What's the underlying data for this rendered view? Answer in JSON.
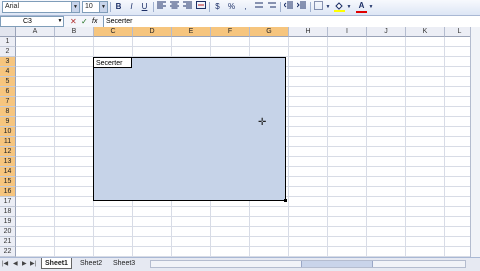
{
  "toolbar": {
    "font_name": "Arial",
    "font_size": "10",
    "bold": "B",
    "italic": "I",
    "underline": "U",
    "currency": "$",
    "percent": "%",
    "comma": ",",
    "fill_color_icon": "paint-bucket-icon",
    "font_color_icon": "font-color-a-icon",
    "font_color_glyph": "A"
  },
  "formula_bar": {
    "name_box": "C3",
    "cancel": "✕",
    "enter": "✓",
    "fx": "fx",
    "content": "Secerter"
  },
  "columns": [
    "A",
    "B",
    "C",
    "D",
    "E",
    "F",
    "G",
    "H",
    "I",
    "J",
    "K",
    "L"
  ],
  "selected_columns": [
    "C",
    "D",
    "E",
    "F",
    "G"
  ],
  "rows": [
    "1",
    "2",
    "3",
    "4",
    "5",
    "6",
    "7",
    "8",
    "9",
    "10",
    "11",
    "12",
    "13",
    "14",
    "15",
    "16",
    "17",
    "18",
    "19",
    "20",
    "21",
    "22"
  ],
  "selected_rows": [
    "3",
    "4",
    "5",
    "6",
    "7",
    "8",
    "9",
    "10",
    "11",
    "12",
    "13",
    "14",
    "15",
    "16"
  ],
  "active_cell": {
    "ref": "C3",
    "value": "Secerter"
  },
  "sheet_tabs": [
    "Sheet1",
    "Sheet2",
    "Sheet3"
  ],
  "active_tab": "Sheet1",
  "colors": {
    "selection": "#c6d3e8",
    "header_highlight": "#f6c57e"
  }
}
